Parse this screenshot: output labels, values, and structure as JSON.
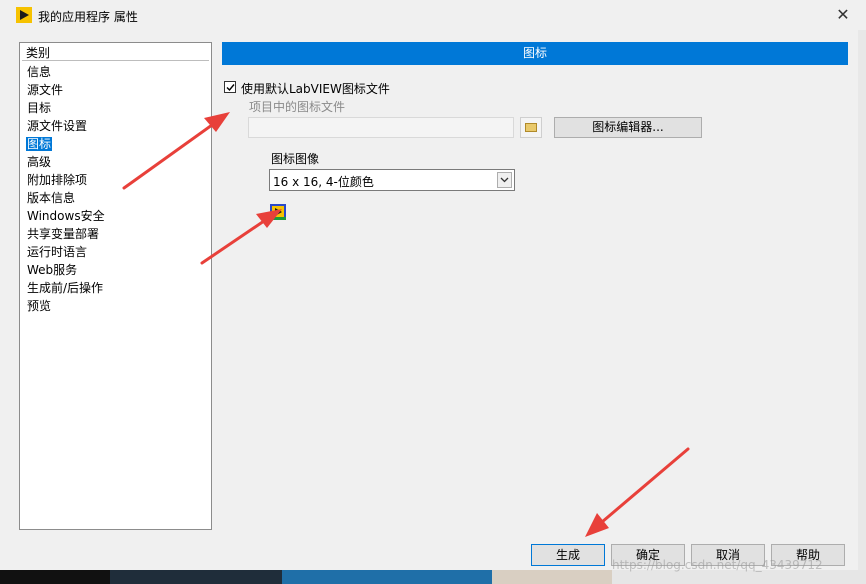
{
  "window": {
    "title": "我的应用程序 属性",
    "close_symbol": "✕"
  },
  "categories": {
    "header": "类别",
    "items": [
      {
        "label": "信息",
        "selected": false
      },
      {
        "label": "源文件",
        "selected": false
      },
      {
        "label": "目标",
        "selected": false
      },
      {
        "label": "源文件设置",
        "selected": false
      },
      {
        "label": "图标",
        "selected": true
      },
      {
        "label": "高级",
        "selected": false
      },
      {
        "label": "附加排除项",
        "selected": false
      },
      {
        "label": "版本信息",
        "selected": false
      },
      {
        "label": "Windows安全",
        "selected": false
      },
      {
        "label": "共享变量部署",
        "selected": false
      },
      {
        "label": "运行时语言",
        "selected": false
      },
      {
        "label": "Web服务",
        "selected": false
      },
      {
        "label": "生成前/后操作",
        "selected": false
      },
      {
        "label": "预览",
        "selected": false
      }
    ]
  },
  "icon_page": {
    "section_title": "图标",
    "use_default_checkbox": {
      "label": "使用默认LabVIEW图标文件",
      "checked": true
    },
    "project_icon_file_label": "项目中的图标文件",
    "project_icon_file_value": "",
    "icon_editor_button": "图标编辑器...",
    "icon_image_label": "图标图像",
    "icon_image_selected": "16 x 16, 4-位颜色"
  },
  "buttons": {
    "build": "生成",
    "ok": "确定",
    "cancel": "取消",
    "help": "帮助"
  },
  "watermark": "https://blog.csdn.net/qq_43439712",
  "colors": {
    "accent": "#0078d7",
    "annotation_arrow": "#e8403a"
  },
  "icons": {
    "app": "labview-app-icon",
    "browse": "folder-icon",
    "preview": "icon-preview-image",
    "dropdown": "chevron-down-icon"
  }
}
